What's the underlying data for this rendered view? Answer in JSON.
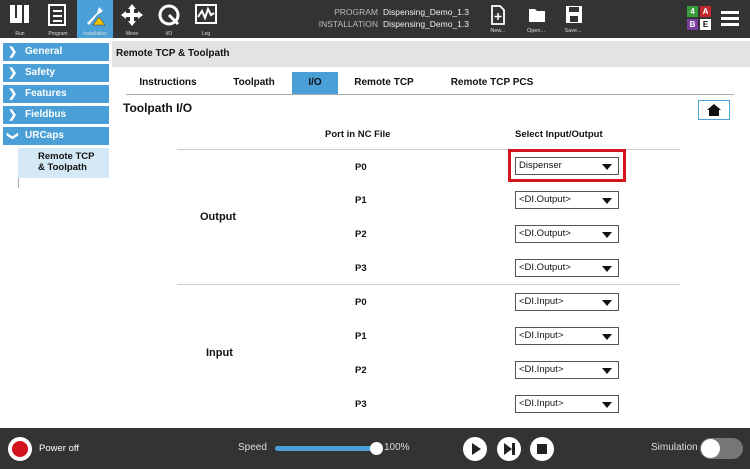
{
  "topbar": {
    "nav": [
      {
        "label": "Run",
        "icon": "ur-logo-icon"
      },
      {
        "label": "Program",
        "icon": "program-icon"
      },
      {
        "label": "Installation",
        "icon": "installation-icon"
      },
      {
        "label": "Move",
        "icon": "move-icon"
      },
      {
        "label": "I/O",
        "icon": "io-icon"
      },
      {
        "label": "Log",
        "icon": "log-icon"
      }
    ],
    "program_label": "PROGRAM",
    "program_value": "Dispensing_Demo_1.3",
    "installation_label": "INSTALLATION",
    "installation_value": "Dispensing_Demo_1.3",
    "new_label": "New...",
    "open_label": "Open...",
    "save_label": "Save...",
    "badges": [
      "4",
      "A",
      "B",
      "E"
    ],
    "badge_colors": [
      "#3a9b3a",
      "#c0282c",
      "#7a3fa0",
      "#ffffff"
    ]
  },
  "sidebar": {
    "items": [
      {
        "label": "General"
      },
      {
        "label": "Safety"
      },
      {
        "label": "Features"
      },
      {
        "label": "Fieldbus"
      },
      {
        "label": "URCaps"
      }
    ],
    "sub_line1": "Remote TCP",
    "sub_line2": "& Toolpath"
  },
  "main": {
    "header": "Remote TCP & Toolpath",
    "tabs": [
      "Instructions",
      "Toolpath",
      "I/O",
      "Remote TCP",
      "Remote TCP PCS"
    ],
    "active_tab": "I/O",
    "title": "Toolpath I/O",
    "col_port": "Port in NC File",
    "col_select": "Select Input/Output",
    "output_label": "Output",
    "input_label": "Input",
    "outputs": [
      {
        "port": "P0",
        "value": "Dispenser"
      },
      {
        "port": "P1",
        "value": "<DI.Output>"
      },
      {
        "port": "P2",
        "value": "<DI.Output>"
      },
      {
        "port": "P3",
        "value": "<DI.Output>"
      }
    ],
    "inputs": [
      {
        "port": "P0",
        "value": "<DI.Input>"
      },
      {
        "port": "P1",
        "value": "<DI.Input>"
      },
      {
        "port": "P2",
        "value": "<DI.Input>"
      },
      {
        "port": "P3",
        "value": "<DI.Input>"
      }
    ]
  },
  "bottombar": {
    "power_label": "Power off",
    "speed_label": "Speed",
    "speed_value": "100%",
    "simulation_label": "Simulation"
  },
  "colors": {
    "accent": "#4a9fd6",
    "highlight": "#d4141c",
    "bar": "#333333"
  }
}
